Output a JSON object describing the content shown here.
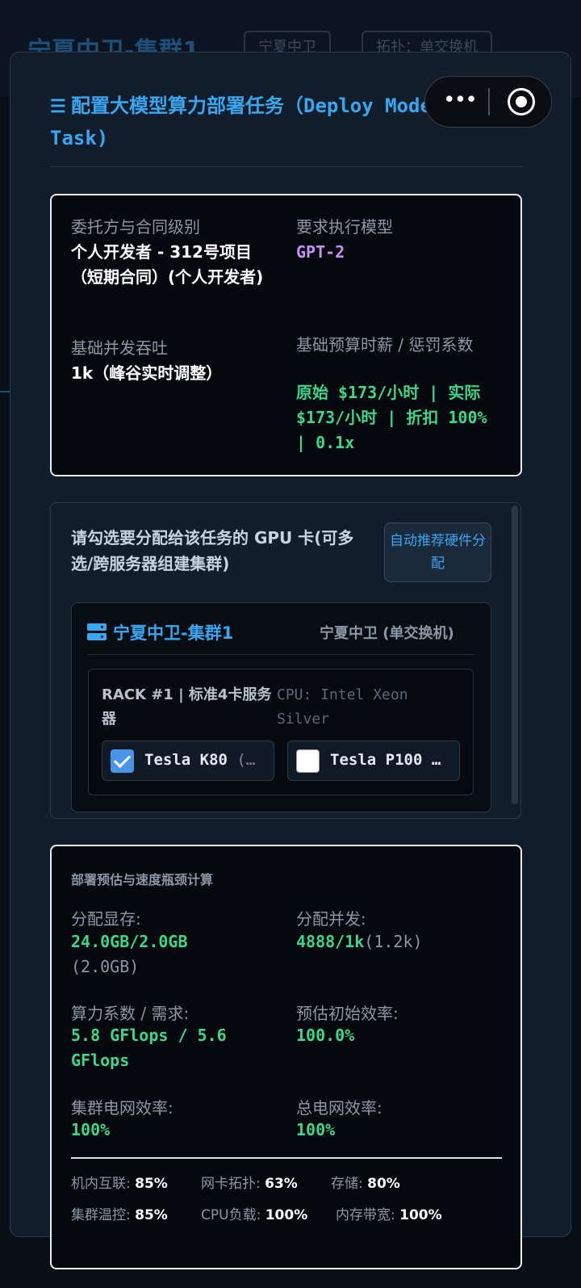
{
  "background": {
    "title": "宁夏中卫-集群1",
    "tags": [
      "宁夏中卫",
      "拓扑：单交换机"
    ]
  },
  "modal": {
    "title_icon": "list-icon",
    "title": "配置大模型算力部署任务（Deploy Model Task)",
    "close": "×"
  },
  "task_info": {
    "client_label": "委托方与合同级别",
    "client_value": "个人开发者 - 312号项目（短期合同）(个人开发者)",
    "model_label": "要求执行模型",
    "model_value": "GPT-2",
    "concurrency_label": "基础并发吞吐",
    "concurrency_value": "1k（峰谷实时调整）",
    "budget_label": "基础预算时薪 / 惩罚系数",
    "budget_value": "原始 $173/小时 | 实际 $173/小时 | 折扣 100% | 0.1x"
  },
  "gpu_select": {
    "prompt": "请勾选要分配给该任务的 GPU 卡(可多选/跨服务器组建集群)",
    "auto_button": "自动推荐硬件分配",
    "cluster": {
      "icon": "server-icon",
      "name": "宁夏中卫-集群1",
      "location": "宁夏中卫 (单交换机)",
      "rack": {
        "name": "RACK #1 | 标准4卡服务器",
        "cpu": "CPU: Intel Xeon Silver",
        "gpus": [
          {
            "name": "Tesla K80",
            "suffix": "(…",
            "checked": true
          },
          {
            "name": "Tesla P100",
            "suffix": "…",
            "checked": false
          }
        ]
      }
    }
  },
  "estimate": {
    "title": "部署预估与速度瓶颈计算",
    "vram_label": "分配显存:",
    "vram_value": "24.0GB/2.0GB",
    "vram_sub": "(2.0GB)",
    "conc_label": "分配并发:",
    "conc_value": "4888/1k",
    "conc_sub": "(1.2k)",
    "flops_label": "算力系数 / 需求:",
    "flops_value": "5.8 GFlops / 5.6 GFlops",
    "eff_label": "预估初始效率:",
    "eff_value": "100.0%",
    "grid_label": "集群电网效率:",
    "grid_value": "100%",
    "total_grid_label": "总电网效率:",
    "total_grid_value": "100%",
    "footer": {
      "interconnect_label": "机内互联:",
      "interconnect_value": "85%",
      "nic_label": "网卡拓扑:",
      "nic_value": "63%",
      "storage_label": "存储:",
      "storage_value": "80%",
      "thermal_label": "集群温控:",
      "thermal_value": "85%",
      "cpu_label": "CPU负载:",
      "cpu_value": "100%",
      "membw_label": "内存带宽:",
      "membw_value": "100%"
    }
  }
}
